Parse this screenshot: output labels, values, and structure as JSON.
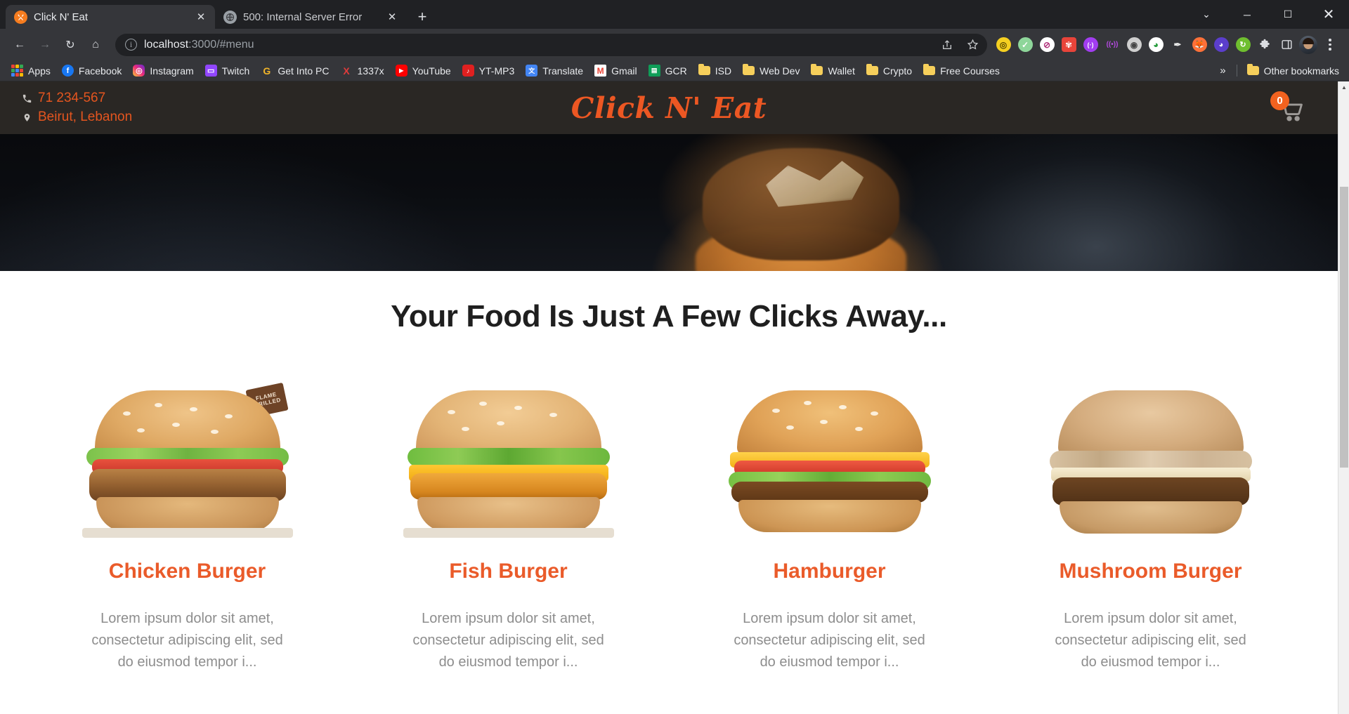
{
  "browser": {
    "tabs": [
      {
        "title": "Click N' Eat",
        "favicon": "fork-knife-icon",
        "active": true,
        "close_label": "✕"
      },
      {
        "title": "500: Internal Server Error",
        "favicon": "globe-icon",
        "active": false,
        "close_label": "✕"
      }
    ],
    "new_tab_label": "+",
    "window_controls": {
      "minimize": "─",
      "maximize": "☐",
      "close": "✕",
      "tab_search": "⌄"
    },
    "nav": {
      "back": "←",
      "forward": "→",
      "reload": "↻",
      "home": "⌂"
    },
    "omnibox": {
      "info_icon_label": "i",
      "url_host": "localhost",
      "url_rest": ":3000/#menu",
      "share_icon": "share-icon",
      "bookmark_icon": "star-icon"
    },
    "extensions": [
      {
        "name": "norton-password-manager",
        "color": "#f5d021",
        "glyph": "◎"
      },
      {
        "name": "adblock-shield",
        "color": "#7ed085",
        "glyph": "✓"
      },
      {
        "name": "ublock-origin",
        "color": "#ffffff",
        "glyph": "⊘"
      },
      {
        "name": "honey-extension",
        "color": "#e8443a",
        "glyph": "✽"
      },
      {
        "name": "grammarly",
        "color": "#a23df0",
        "glyph": "(•)"
      },
      {
        "name": "rss-feed",
        "color": "#b44ae0",
        "glyph": "((•))"
      },
      {
        "name": "video-downloader",
        "color": "#d8d8d8",
        "glyph": "◉"
      },
      {
        "name": "internet-download-manager",
        "color": "#3cb44a",
        "glyph": "⇣"
      },
      {
        "name": "color-picker",
        "color": "#e9e9e9",
        "glyph": "✒"
      },
      {
        "name": "firefox-send",
        "color": "#ff7139",
        "glyph": "◑"
      },
      {
        "name": "ghostery",
        "color": "#5b3ecc",
        "glyph": "●"
      },
      {
        "name": "video-grabber",
        "color": "#6fbf2f",
        "glyph": "↻"
      }
    ],
    "toolbar_right": {
      "extensions_puzzle": "puzzle-icon",
      "sidepanel": "side-panel-icon",
      "profile": "avatar",
      "menu": "kebab-menu-icon"
    },
    "bookmarks": [
      {
        "label": "Apps",
        "icon": "apps-grid-icon"
      },
      {
        "label": "Facebook",
        "icon": "facebook-icon",
        "color": "#1877f2",
        "glyph": "f"
      },
      {
        "label": "Instagram",
        "icon": "instagram-icon",
        "color": "#c13584",
        "glyph": "◎"
      },
      {
        "label": "Twitch",
        "icon": "twitch-icon",
        "color": "#9146ff",
        "glyph": "▭"
      },
      {
        "label": "Get Into PC",
        "icon": "getintopc-icon",
        "color": "#f0b429",
        "glyph": "G"
      },
      {
        "label": "1337x",
        "icon": "1337x-icon",
        "color": "#e03b3b",
        "glyph": "X"
      },
      {
        "label": "YouTube",
        "icon": "youtube-icon",
        "color": "#ff0000",
        "glyph": "▶"
      },
      {
        "label": "YT-MP3",
        "icon": "ytmp3-icon",
        "color": "#e02020",
        "glyph": "♪"
      },
      {
        "label": "Translate",
        "icon": "translate-icon",
        "color": "#4285f4",
        "glyph": "文"
      },
      {
        "label": "Gmail",
        "icon": "gmail-icon",
        "color": "#ea4335",
        "glyph": "M"
      },
      {
        "label": "GCR",
        "icon": "classroom-icon",
        "color": "#0f9d58",
        "glyph": "▤"
      },
      {
        "label": "ISD",
        "icon": "folder-icon"
      },
      {
        "label": "Web Dev",
        "icon": "folder-icon"
      },
      {
        "label": "Wallet",
        "icon": "folder-icon"
      },
      {
        "label": "Crypto",
        "icon": "folder-icon"
      },
      {
        "label": "Free Courses",
        "icon": "folder-icon"
      }
    ],
    "bookmarks_overflow": "»",
    "other_bookmarks": {
      "label": "Other bookmarks",
      "icon": "folder-icon"
    }
  },
  "site": {
    "header": {
      "phone": "71 234-567",
      "phone_icon": "phone-icon",
      "location": "Beirut, Lebanon",
      "location_icon": "map-pin-icon",
      "logo": "Click N' Eat",
      "cart_icon": "shopping-cart-icon",
      "cart_count": "0"
    },
    "hero": {
      "alt": "grilled-burger-hero-image"
    },
    "section_title": "Your Food Is Just A Few Clicks Away...",
    "products": [
      {
        "name": "Chicken Burger",
        "description": "Lorem ipsum dolor sit amet, consectetur adipiscing elit, sed do eiusmod tempor i...",
        "image": "chicken-burger-image",
        "badge": "FLAME GRILLED"
      },
      {
        "name": "Fish Burger",
        "description": "Lorem ipsum dolor sit amet, consectetur adipiscing elit, sed do eiusmod tempor i...",
        "image": "fish-burger-image",
        "badge": ""
      },
      {
        "name": "Hamburger",
        "description": "Lorem ipsum dolor sit amet, consectetur adipiscing elit, sed do eiusmod tempor i...",
        "image": "hamburger-image",
        "badge": ""
      },
      {
        "name": "Mushroom Burger",
        "description": "Lorem ipsum dolor sit amet, consectetur adipiscing elit, sed do eiusmod tempor i...",
        "image": "mushroom-burger-image",
        "badge": ""
      }
    ],
    "colors": {
      "accent": "#ea5b2a",
      "header_bg": "#2a2724",
      "title": "#1f1f1f",
      "desc": "#8d8d8d"
    }
  },
  "scrollbar": {
    "up_arrow": "▲",
    "down_arrow": "▼"
  }
}
